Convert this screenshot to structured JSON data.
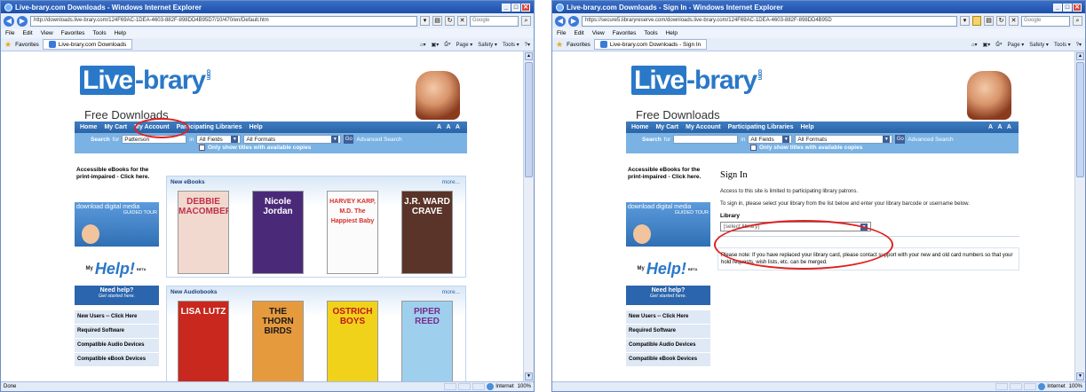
{
  "left": {
    "title": "Live-brary.com Downloads - Windows Internet Explorer",
    "url": "http://downloads.live-brary.com/124F69AC-1DEA-4603-882F-898DD4B95D7/10/470/en/Default.htm",
    "menu": [
      "File",
      "Edit",
      "View",
      "Favorites",
      "Tools",
      "Help"
    ],
    "search_placeholder": "Google",
    "favorites_label": "Favorites",
    "tab_label": "Live-brary.com Downloads",
    "commands": [
      "Page ▾",
      "Safety ▾",
      "Tools ▾"
    ],
    "status_left": "Done",
    "status_zone": "Internet",
    "status_zoom": "100%"
  },
  "right": {
    "title": "Live-brary.com Downloads - Sign In - Windows Internet Explorer",
    "url": "https://secure5.libraryreserve.com/downloads.live-brary.com/124F69AC-1DEA-4603-882F-898DD4B95D",
    "menu": [
      "File",
      "Edit",
      "View",
      "Favorites",
      "Tools",
      "Help"
    ],
    "search_placeholder": "Google",
    "favorites_label": "Favorites",
    "tab_label": "Live-brary.com Downloads - Sign In",
    "commands": [
      "Page ▾",
      "Safety ▾",
      "Tools ▾"
    ],
    "status_left": "",
    "status_zone": "Internet",
    "status_zoom": "100%"
  },
  "site": {
    "logo_boxed": "Live",
    "logo_rest": "-brary",
    "logo_com": "com",
    "tagline": "Free Downloads",
    "nav": [
      "Home",
      "My Cart",
      "My Account",
      "Participating Libraries",
      "Help"
    ],
    "text_size": "A A A",
    "search_label": "Search",
    "search_for": "for",
    "search_value_left": "Patterson",
    "search_value_right": "",
    "in_label": "in",
    "fields_select": "All Fields",
    "formats_select": "All Formats",
    "go": "Go",
    "advanced": "Advanced Search",
    "only_available": "Only show titles with available copies",
    "sidebar": {
      "accessible": "Accessible eBooks for the print-impaired - Click here.",
      "download_banner": "download digital media",
      "download_sub": "GUIDED TOUR",
      "myhelp_my": "My",
      "myhelp": "Help!",
      "beta": "BETA",
      "need_help": "Need help?",
      "get_started": "Get started here.",
      "links": [
        "New Users -- Click Here",
        "Required Software",
        "Compatible Audio Devices",
        "Compatible eBook Devices"
      ]
    }
  },
  "main_left": {
    "ebooks_heading": "New eBooks",
    "audiobooks_heading": "New Audiobooks",
    "more": "more...",
    "ebooks": [
      {
        "text": "DEBBIE MACOMBER",
        "bg": "#f1d9cf",
        "fg": "#c0304a"
      },
      {
        "text": "Nicole Jordan",
        "bg": "#4a2a78",
        "fg": "#ffffff"
      },
      {
        "text": "HARVEY KARP, M.D. The Happiest Baby",
        "bg": "#fbfbfb",
        "fg": "#d4302a"
      },
      {
        "text": "J.R. WARD CRAVE",
        "bg": "#5a3428",
        "fg": "#ffffff"
      }
    ],
    "audiobooks": [
      {
        "text": "LISA LUTZ",
        "bg": "#c8281e",
        "fg": "#ffffff"
      },
      {
        "text": "THE THORN BIRDS",
        "bg": "#e69a3e",
        "fg": "#1a1a1a"
      },
      {
        "text": "OSTRICH BOYS",
        "bg": "#f0d21a",
        "fg": "#c0181a"
      },
      {
        "text": "PIPER REED",
        "bg": "#9ed0ee",
        "fg": "#7a2a8c"
      }
    ]
  },
  "main_right": {
    "heading": "Sign In",
    "p1": "Access to this site is limited to participating library patrons.",
    "p2": "To sign in, please select your library from the list below and enter your library barcode or username below.",
    "library_label": "Library",
    "library_select": "[select library]",
    "note": "Please note: If you have replaced your library card, please contact support with your new and old card numbers so that your hold requests, wish lists, etc. can be merged."
  },
  "colors": {
    "highlight": "#e02020",
    "nav": "#2a64a8",
    "logo": "#2a78c8"
  }
}
